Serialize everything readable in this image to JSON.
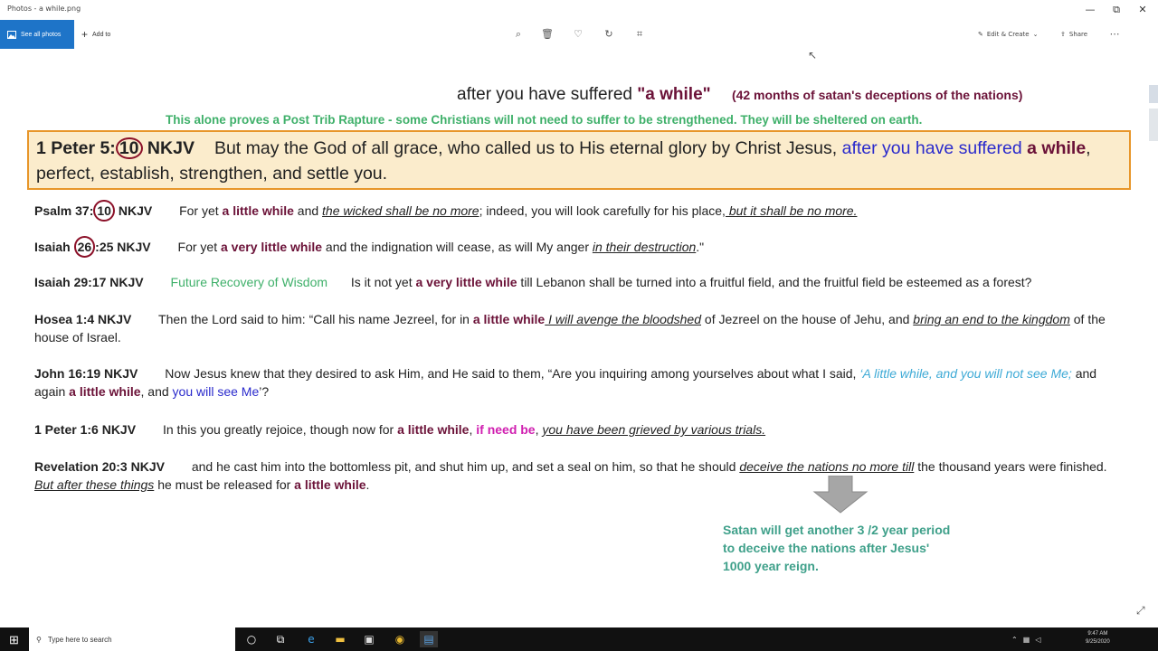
{
  "window": {
    "title": "Photos - a while.png",
    "controls": {
      "minimize": "—",
      "maximize": "⧉",
      "close": "✕"
    }
  },
  "toolbar": {
    "see_all": "See all photos",
    "add_to": "Add to",
    "icons": [
      "zoom-icon",
      "delete-icon",
      "favorite-icon",
      "rotate-icon",
      "crop-icon"
    ],
    "edit_create": "Edit & Create",
    "share": "Share"
  },
  "document": {
    "header_prefix": "after you have suffered",
    "header_quote": "\"a while\"",
    "header_note": "(42 months of satan's deceptions of the nations)",
    "proves_line": "This alone proves a Post Trib Rapture - some Christians will not need to suffer to be strengthened. They will be sheltered on earth.",
    "main": {
      "ref_a": "1 Peter 5:",
      "ref_num": "10",
      "ref_b": " NKJV",
      "text1": "But may the God of all grace, who called us to His eternal glory by Christ Jesus,",
      "text_blue": " after you have suffered",
      "text_mar": " a while",
      "text2": ", perfect, establish, strengthen, and settle you."
    },
    "psalm": {
      "ref_a": "Psalm 37:",
      "ref_num": "10",
      "ref_b": " NKJV",
      "t1": "For yet",
      "m1": " a little while",
      "t2": " and ",
      "u1": "the wicked shall be no more",
      "t3": "; indeed, you will look carefully for his place,",
      "u2": " but it shall be no more."
    },
    "isaiah26": {
      "ref_a": "Isaiah ",
      "ref_num": "26",
      "ref_b": ":25 NKJV",
      "t1": "For yet",
      "m1": " a very little while",
      "t2": " and the indignation will cease, as will My anger ",
      "u1": "in their destruction",
      "t3": ".\""
    },
    "isaiah29": {
      "ref": "Isaiah 29:17 NKJV",
      "green": "Future Recovery of Wisdom",
      "t1": "Is it not yet",
      "m1": " a very little while",
      "t2": " till Lebanon shall be turned into a fruitful field, and the fruitful field be esteemed as a forest?"
    },
    "hosea": {
      "ref": "Hosea 1:4 NKJV",
      "t1": "Then the Lord said to him: “Call his name Jezreel, for in",
      "m1": " a little while",
      "u1": " I will avenge the bloodshed",
      "t2": " of Jezreel on the house of Jehu, and ",
      "u2": "bring an end to the kingdom",
      "t3": " of the house of Israel."
    },
    "john": {
      "ref": "John 16:19 NKJV",
      "t1": "Now Jesus knew that they desired to ask Him, and He said to them, “Are you inquiring among yourselves about what I said, ",
      "teal": "‘A little while, and you will not see Me;",
      "t2": " and again",
      "m1": " a little while",
      "t3": ", and ",
      "blue": "you will see Me",
      "t4": "’?"
    },
    "peter16": {
      "ref": "1 Peter 1:6 NKJV",
      "t1": "In this you greatly rejoice, though now for",
      "m1": " a little while",
      "t2": ", ",
      "mag": "if need be",
      "t3": ", ",
      "u1": "you have been grieved by various trials."
    },
    "revelation": {
      "ref": "Revelation 20:3 NKJV",
      "t1": "and he cast him into the bottomless pit, and shut him up, and set a seal on him, so that he should ",
      "u1": "deceive the nations no more till",
      "t2": " the thousand years were finished. ",
      "u2": "But after these things",
      "t3": " he must be released for",
      "m1": " a little while",
      "t4": "."
    },
    "satan_note": [
      "Satan will get another 3 /2 year period",
      "to deceive the nations after Jesus'",
      "1000 year reign."
    ]
  },
  "taskbar": {
    "search_placeholder": "Type here to search",
    "apps": [
      "cortana-icon",
      "task-view-icon",
      "edge-icon",
      "file-explorer-icon",
      "store-icon",
      "chrome-icon",
      "photos-icon"
    ],
    "time": "9:47 AM",
    "date": "9/25/2020"
  },
  "colors": {
    "accent": "#1e74c8",
    "maroon": "#6b1238",
    "green": "#3fb06a",
    "blue": "#2a2acc",
    "teal": "#3eaad6",
    "magenta": "#d01fb0",
    "box_fill": "#fbeccc",
    "box_border": "#e8962a"
  }
}
